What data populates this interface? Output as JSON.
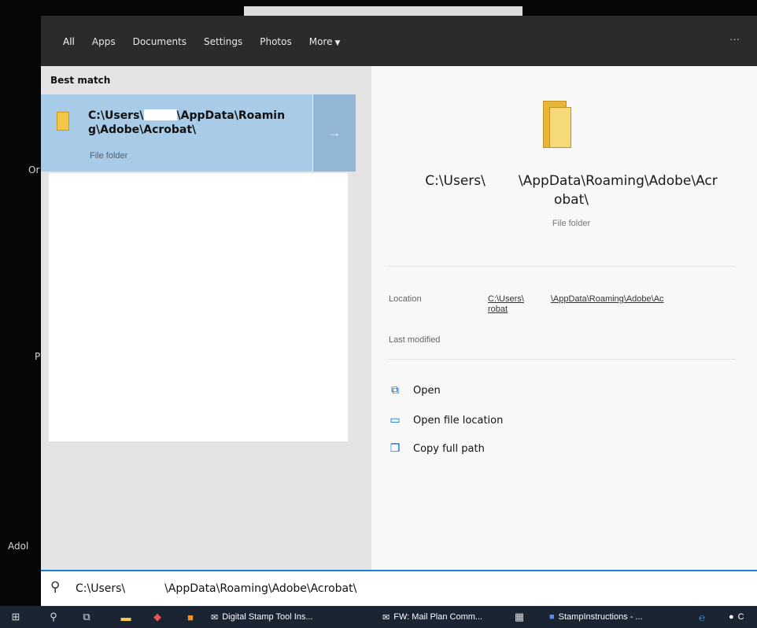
{
  "filters": {
    "tabs": [
      "All",
      "Apps",
      "Documents",
      "Settings",
      "Photos"
    ],
    "more_label": "More",
    "overflow": "···"
  },
  "left_pane": {
    "section_label": "Best match",
    "result": {
      "title_line1_a": "C:\\Users\\",
      "title_line1_b": "\\AppData\\Roamin",
      "title_line2": "g\\Adobe\\Acrobat\\",
      "type": "File folder"
    }
  },
  "preview": {
    "title_line1_a": "C:\\Users\\",
    "title_line1_b": "\\AppData\\Roaming\\Adobe\\Acr",
    "title_line2": "obat\\",
    "type": "File folder",
    "location_label": "Location",
    "location_value_a": "C:\\Users\\",
    "location_value_b": "\\AppData\\Roaming\\Adobe\\Ac",
    "location_value_c": "robat",
    "last_modified_label": "Last modified",
    "actions": [
      {
        "label": "Open",
        "icon": "open-icon"
      },
      {
        "label": "Open file location",
        "icon": "folder-location-icon"
      },
      {
        "label": "Copy full path",
        "icon": "copy-icon"
      }
    ]
  },
  "search": {
    "query_a": "C:\\Users\\",
    "query_b": "\\AppData\\Roaming\\Adobe\\Acrobat\\"
  },
  "desktop_labels": [
    "Or",
    "P",
    "Adol"
  ],
  "taskbar": {
    "items": [
      {
        "label": "Digital Stamp Tool Ins...",
        "icon": "mail-icon"
      },
      {
        "label": "FW: Mail Plan Comm...",
        "icon": "mail-icon"
      },
      {
        "label": "StampInstructions - ...",
        "icon": "word-icon"
      },
      {
        "label": "C",
        "icon": "chrome-icon"
      }
    ]
  },
  "colors": {
    "selection": "#a8cbe8",
    "accent": "#1c7ed6",
    "filter_bar": "#2b2b2b",
    "taskbar": "#1a2433"
  }
}
